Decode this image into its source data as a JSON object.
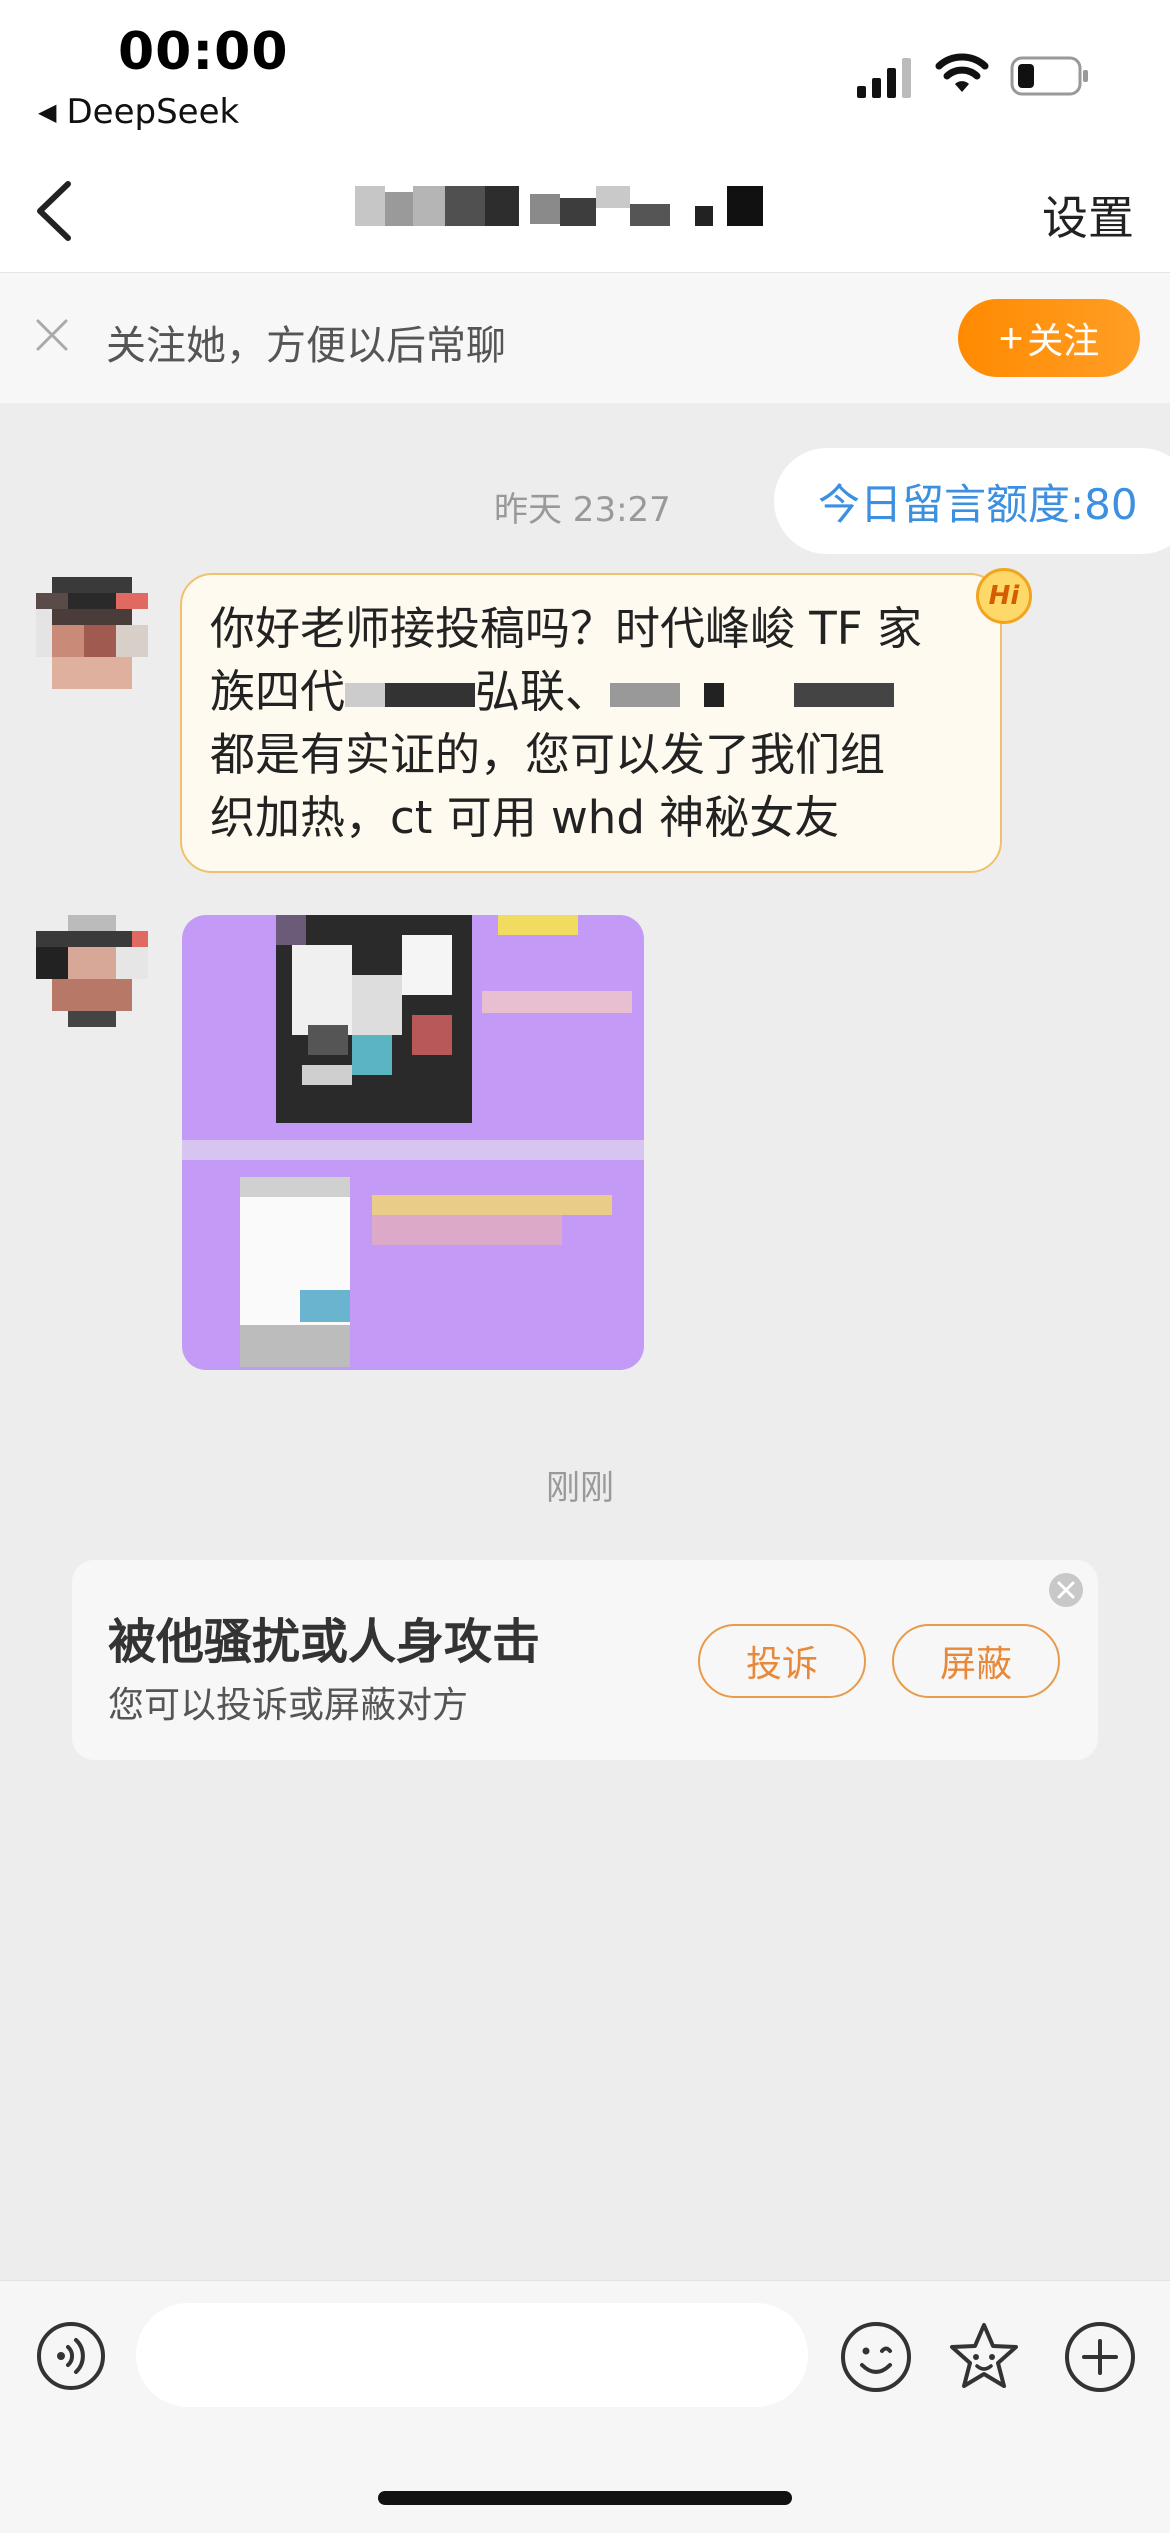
{
  "status": {
    "time": "00:00",
    "back_app": "DeepSeek"
  },
  "nav": {
    "settings": "设置"
  },
  "follow_bar": {
    "text": "关注她，方便以后常聊",
    "button": "关注",
    "button_icon": "plus-icon"
  },
  "quota": "今日留言额度:80",
  "messages": [
    {
      "time": "昨天 23:27",
      "lines": [
        "你好老师接投稿吗？时代峰峻 TF 家",
        "族四代",
        "弘联、",
        "都是有实证的，您可以发了我们组",
        "织加热，ct 可用 whd 神秘女友"
      ]
    }
  ],
  "hi_badge": "Hi",
  "second_time": "刚刚",
  "harass": {
    "title": "被他骚扰或人身攻击",
    "subtitle": "您可以投诉或屏蔽对方",
    "report": "投诉",
    "block": "屏蔽"
  },
  "colors": {
    "accent": "#ff8a00",
    "quota_text": "#3d8fe0",
    "bubble_bg": "#fffaf0",
    "bubble_border": "#f0c16c",
    "image_bg": "#c39af6"
  }
}
